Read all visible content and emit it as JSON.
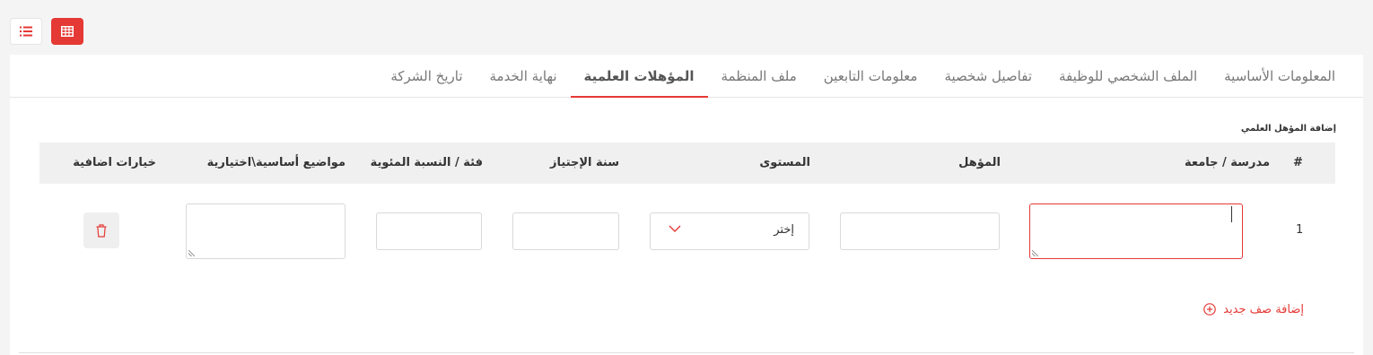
{
  "tabs": [
    {
      "label": "المعلومات الأساسية",
      "active": false
    },
    {
      "label": "الملف الشخصي للوظيفة",
      "active": false
    },
    {
      "label": "تفاصيل شخصية",
      "active": false
    },
    {
      "label": "معلومات التابعين",
      "active": false
    },
    {
      "label": "ملف المنظمة",
      "active": false
    },
    {
      "label": "المؤهلات العلمية",
      "active": true
    },
    {
      "label": "نهاية الخدمة",
      "active": false
    },
    {
      "label": "تاريخ الشركة",
      "active": false
    }
  ],
  "section_title": "إضافة المؤهل العلمي",
  "table": {
    "headers": {
      "num": "#",
      "school": "مدرسة / جامعة",
      "qualification": "المؤهل",
      "level": "المستوى",
      "year": "سنة الإجتياز",
      "grade": "فئة / النسبة المئوية",
      "subjects": "مواضيع أساسية\\اختيارية",
      "options": "خيارات اضافية"
    },
    "rows": [
      {
        "num": "1",
        "school": "",
        "qualification": "",
        "level": "إختر",
        "year": "",
        "grade": "",
        "subjects": ""
      }
    ]
  },
  "add_row_label": "إضافة صف جديد",
  "colors": {
    "accent": "#e53935"
  }
}
